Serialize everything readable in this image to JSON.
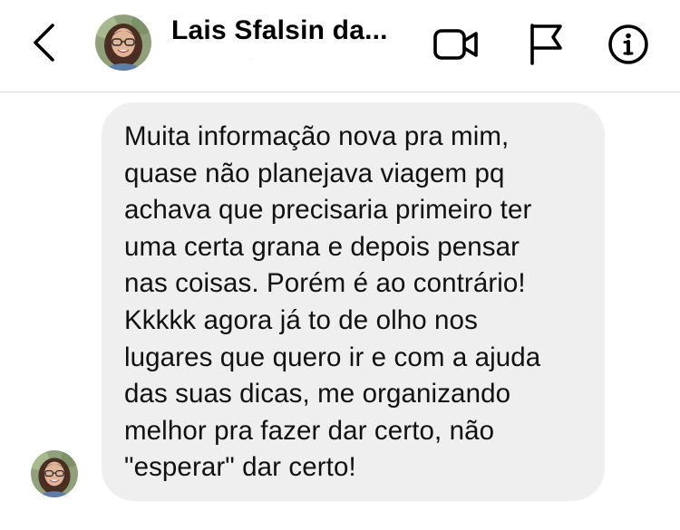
{
  "header": {
    "back_icon": "chevron-left-icon",
    "avatar_icon": "profile-photo",
    "contact_name": "Lais Sfalsin da...",
    "subtitle": "·",
    "video_call_icon": "video-camera-icon",
    "report_icon": "flag-icon",
    "info_icon": "info-icon"
  },
  "conversation": {
    "messages": [
      {
        "sender": "contact",
        "avatar_icon": "profile-photo",
        "text": "Muita informação nova pra mim,\nquase não planejava viagem pq\nachava que precisaria primeiro ter\numa certa grana e depois pensar\nnas coisas. Porém é ao contrário!\nKkkkk  agora já to de olho nos\nlugares que quero ir e com a ajuda\ndas suas dicas, me organizando\nmelhor pra fazer dar certo, não\n\"esperar\" dar certo!"
      }
    ]
  },
  "colors": {
    "bubble_background": "#efefef",
    "header_divider": "#dbdbdb",
    "text": "#111111"
  }
}
